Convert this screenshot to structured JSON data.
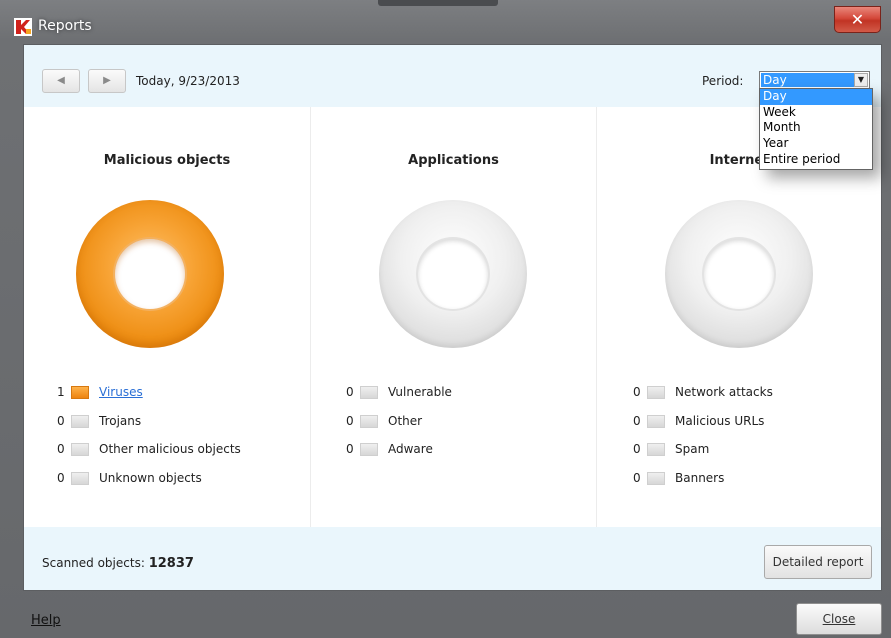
{
  "window": {
    "title": "Reports",
    "close_glyph": "✕"
  },
  "toolbar": {
    "prev_glyph": "◀",
    "next_glyph": "▶",
    "date": "Today, 9/23/2013",
    "period_label": "Period:",
    "period_value": "Day",
    "period_options": [
      "Day",
      "Week",
      "Month",
      "Year",
      "Entire period"
    ]
  },
  "columns": [
    {
      "title": "Malicious objects",
      "items": [
        {
          "count": "1",
          "label": "Viruses"
        },
        {
          "count": "0",
          "label": "Trojans"
        },
        {
          "count": "0",
          "label": "Other malicious objects"
        },
        {
          "count": "0",
          "label": "Unknown objects"
        }
      ]
    },
    {
      "title": "Applications",
      "items": [
        {
          "count": "0",
          "label": "Vulnerable"
        },
        {
          "count": "0",
          "label": "Other"
        },
        {
          "count": "0",
          "label": "Adware"
        }
      ]
    },
    {
      "title": "Internet",
      "items": [
        {
          "count": "0",
          "label": "Network attacks"
        },
        {
          "count": "0",
          "label": "Malicious URLs"
        },
        {
          "count": "0",
          "label": "Spam"
        },
        {
          "count": "0",
          "label": "Banners"
        }
      ]
    }
  ],
  "footer": {
    "scanned_label": "Scanned objects:",
    "scanned_value": "12837",
    "detailed_report_label": "Detailed report",
    "help_label": "Help",
    "close_label": "Close"
  },
  "colors": {
    "accent_orange": "#f39a27",
    "selection_blue": "#3399ff",
    "panel_bg": "#eaf6fc",
    "close_red": "#c9372a"
  },
  "icons": {
    "app_icon": "kaspersky-logo-icon",
    "dropdown_arrow": "chevron-down-icon"
  }
}
